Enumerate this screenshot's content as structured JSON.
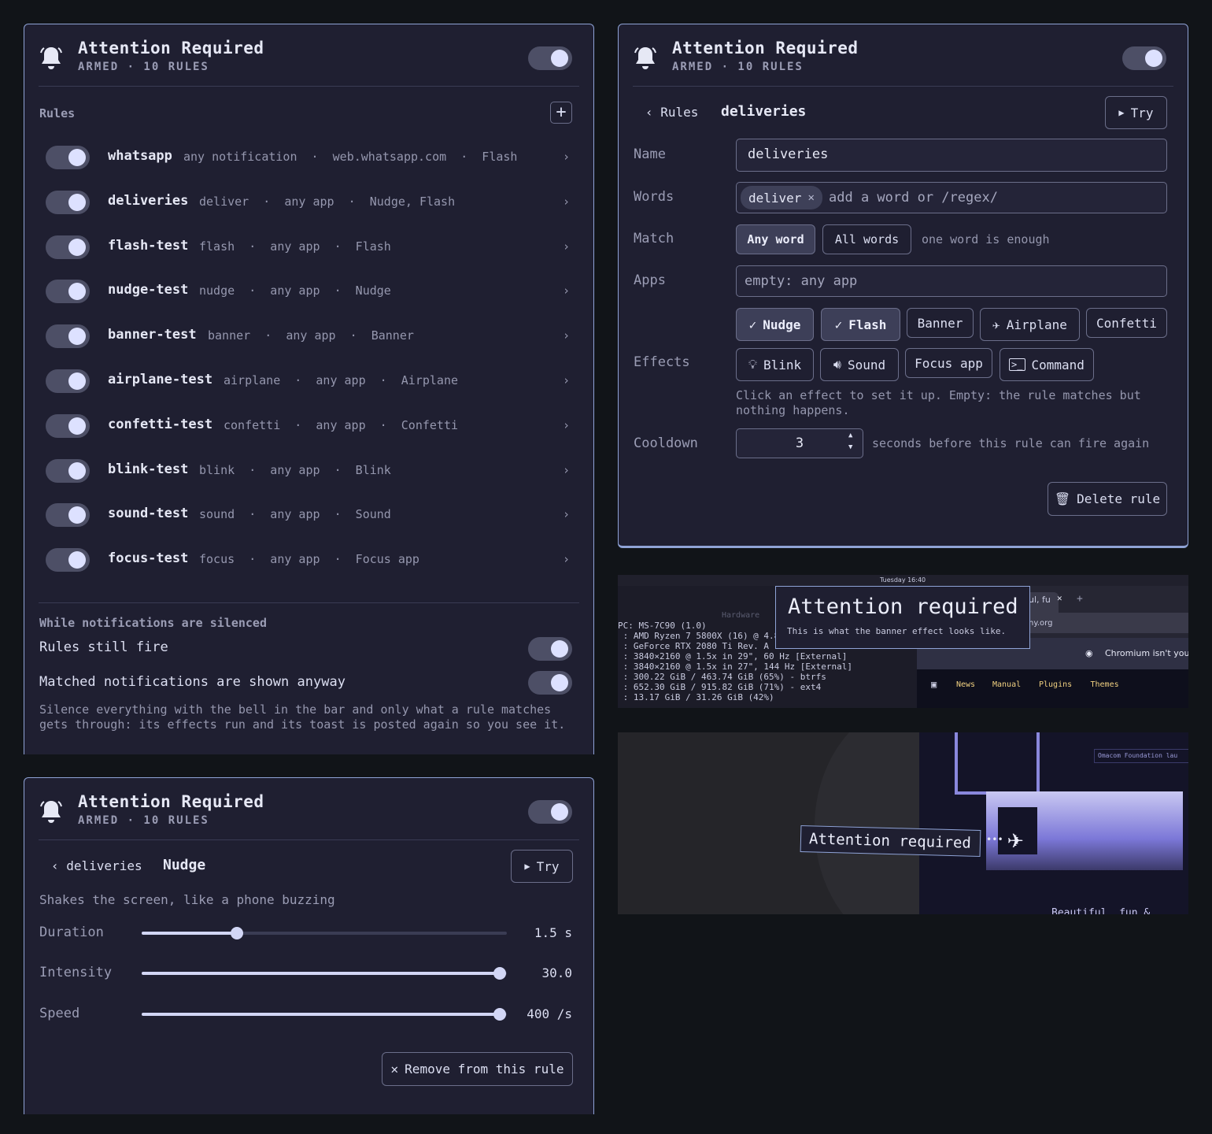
{
  "header": {
    "title": "Attention Required",
    "status": "ARMED · 10 RULES"
  },
  "rules_panel": {
    "rules_label": "Rules",
    "rules": [
      {
        "name": "whatsapp",
        "desc": "any notification  ·  web.whatsapp.com  ·  Flash"
      },
      {
        "name": "deliveries",
        "desc": "deliver  ·  any app  ·  Nudge, Flash"
      },
      {
        "name": "flash-test",
        "desc": "flash  ·  any app  ·  Flash"
      },
      {
        "name": "nudge-test",
        "desc": "nudge  ·  any app  ·  Nudge"
      },
      {
        "name": "banner-test",
        "desc": "banner  ·  any app  ·  Banner"
      },
      {
        "name": "airplane-test",
        "desc": "airplane  ·  any app  ·  Airplane"
      },
      {
        "name": "confetti-test",
        "desc": "confetti  ·  any app  ·  Confetti"
      },
      {
        "name": "blink-test",
        "desc": "blink  ·  any app  ·  Blink"
      },
      {
        "name": "sound-test",
        "desc": "sound  ·  any app  ·  Sound"
      },
      {
        "name": "focus-test",
        "desc": "focus  ·  any app  ·  Focus app"
      }
    ],
    "silenced_heading": "While notifications are silenced",
    "opt_fire": "Rules still fire",
    "opt_shown": "Matched notifications are shown anyway",
    "silence_help_1": "Silence everything with the bell in the bar and only what a rule matches",
    "silence_help_2": "gets through: its effects run and its toast is posted again so you see it."
  },
  "rule_editor": {
    "back_label": "Rules",
    "current": "deliveries",
    "try_label": "Try",
    "name_label": "Name",
    "name_value": "deliveries",
    "words_label": "Words",
    "word_chip": "deliver",
    "words_placeholder": "add a word or /regex/",
    "match_label": "Match",
    "match_any": "Any word",
    "match_all": "All words",
    "match_hint": "one word is enough",
    "apps_label": "Apps",
    "apps_placeholder": "empty: any app",
    "effects_label": "Effects",
    "effects": [
      "Nudge",
      "Flash",
      "Banner",
      "Airplane",
      "Confetti",
      "Blink",
      "Sound",
      "Focus app",
      "Command"
    ],
    "effects_help_1": "Click an effect to set it up. Empty: the rule matches but",
    "effects_help_2": "nothing happens.",
    "cooldown_label": "Cooldown",
    "cooldown_value": "3",
    "cooldown_hint": "seconds before this rule can fire again",
    "delete_label": "Delete rule"
  },
  "effect_editor": {
    "back_label": "deliveries",
    "current": "Nudge",
    "try_label": "Try",
    "description": "Shakes the screen, like a phone buzzing",
    "sliders": [
      {
        "label": "Duration",
        "value_text": "1.5 s",
        "fraction": 0.26
      },
      {
        "label": "Intensity",
        "value_text": "30.0",
        "fraction": 0.98
      },
      {
        "label": "Speed",
        "value_text": "400 /s",
        "fraction": 0.98
      }
    ],
    "remove_label": "Remove from this rule"
  },
  "preview_banner": {
    "topbar": "Tuesday 16:40",
    "hardware_label": "Hardware",
    "sysinfo": [
      "PC: MS-7C90 (1.0)",
      " : AMD Ryzen 7 5800X (16) @ 4.8",
      " : GeForce RTX 2080 Ti Rev. A",
      " : 3840×2160 @ 1.5x in 29\", 60 Hz [External]",
      " : 3840×2160 @ 1.5x in 27\", 144 Hz [External]",
      " : 300.22 GiB / 463.74 GiB (65%) - btrfs",
      " : 652.30 GiB / 915.82 GiB (71%) - ext4",
      " : 13.17 GiB / 31.26 GiB (42%)"
    ],
    "banner_title": "Attention required",
    "banner_text": "This is what the banner effect looks like.",
    "tab_text": "ul, fu",
    "url_text": "hy.org",
    "chromium_text": "Chromium isn't you",
    "nav": [
      "News",
      "Manual",
      "Plugins",
      "Themes"
    ]
  },
  "preview_airplane": {
    "banner_text": "Attention required",
    "site_badge": "Omacom Foundation lau",
    "footer_text": "Beautiful, fun &"
  },
  "colors": {
    "panel": "#1f1f31",
    "border": "#8fa3d6",
    "accent": "#dde1ff",
    "page": "#111418"
  }
}
